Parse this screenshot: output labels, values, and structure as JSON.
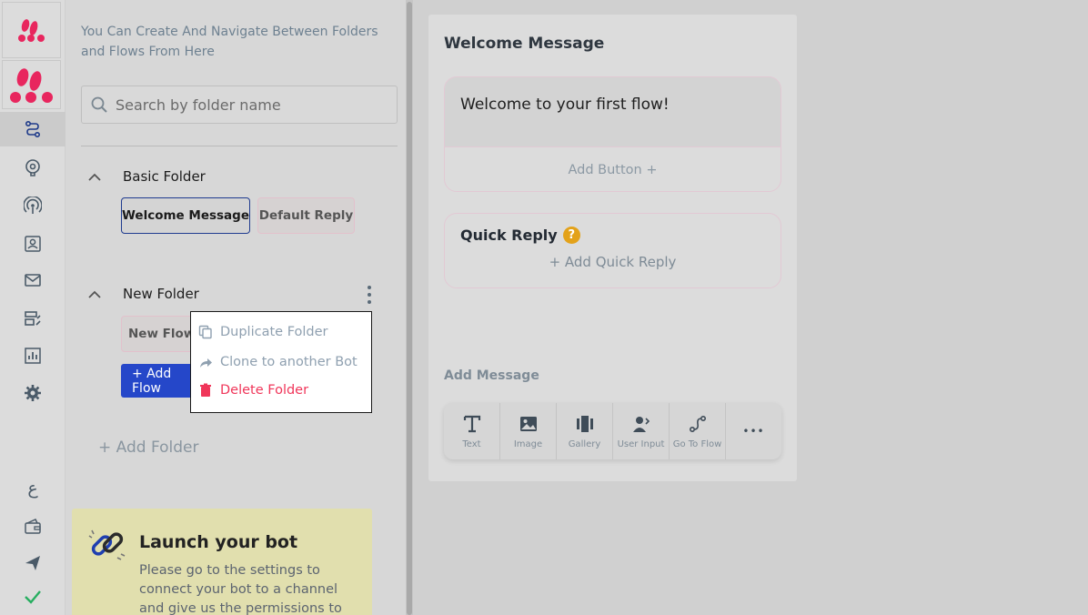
{
  "colors": {
    "brand": "#e8265e",
    "primary_blue": "#2547c9",
    "danger": "#f0365a",
    "muted_text": "#8fa0b0",
    "launch_bg": "#e1dfae",
    "help_badge": "#e3a21a"
  },
  "rail": {
    "icons": [
      "brand-logo",
      "brand-logo-large",
      "flows-icon",
      "ai-brain-icon",
      "broadcast-icon",
      "contacts-icon",
      "mail-icon",
      "integrations-icon",
      "analytics-icon",
      "settings-icon",
      "language-icon",
      "wallet-icon",
      "send-icon",
      "check-icon"
    ],
    "language_glyph": "ع"
  },
  "sidebar": {
    "intro": "You Can Create And Navigate Between Folders and Flows From Here",
    "search_placeholder": "Search by folder name",
    "folders": [
      {
        "name": "Basic Folder",
        "flows": [
          "Welcome Message",
          "Default Reply"
        ]
      },
      {
        "name": "New Folder",
        "flows": [
          "New Flow"
        ],
        "add_flow_label": "+ Add Flow"
      }
    ],
    "add_folder_label": "+ Add Folder",
    "launch": {
      "title": "Launch your bot",
      "text": "Please go to the settings to connect your bot to a channel and give us the permissions to"
    }
  },
  "context_menu": {
    "items": [
      {
        "label": "Duplicate Folder",
        "icon": "copy-icon"
      },
      {
        "label": "Clone to another Bot",
        "icon": "share-icon"
      },
      {
        "label": "Delete Folder",
        "icon": "trash-icon"
      }
    ]
  },
  "editor": {
    "title": "Welcome Message",
    "message_text": "Welcome to your first flow!",
    "add_button_label": "Add Button +",
    "quick_reply": {
      "title": "Quick Reply",
      "help_glyph": "?",
      "add_label": "+ Add Quick Reply"
    },
    "add_message_label": "Add Message",
    "tools": [
      {
        "label": "Text",
        "icon": "text-icon"
      },
      {
        "label": "Image",
        "icon": "image-icon"
      },
      {
        "label": "Gallery",
        "icon": "gallery-icon"
      },
      {
        "label": "User Input",
        "icon": "user-input-icon"
      },
      {
        "label": "Go To Flow",
        "icon": "go-to-flow-icon"
      }
    ],
    "more_glyph": "•••"
  }
}
